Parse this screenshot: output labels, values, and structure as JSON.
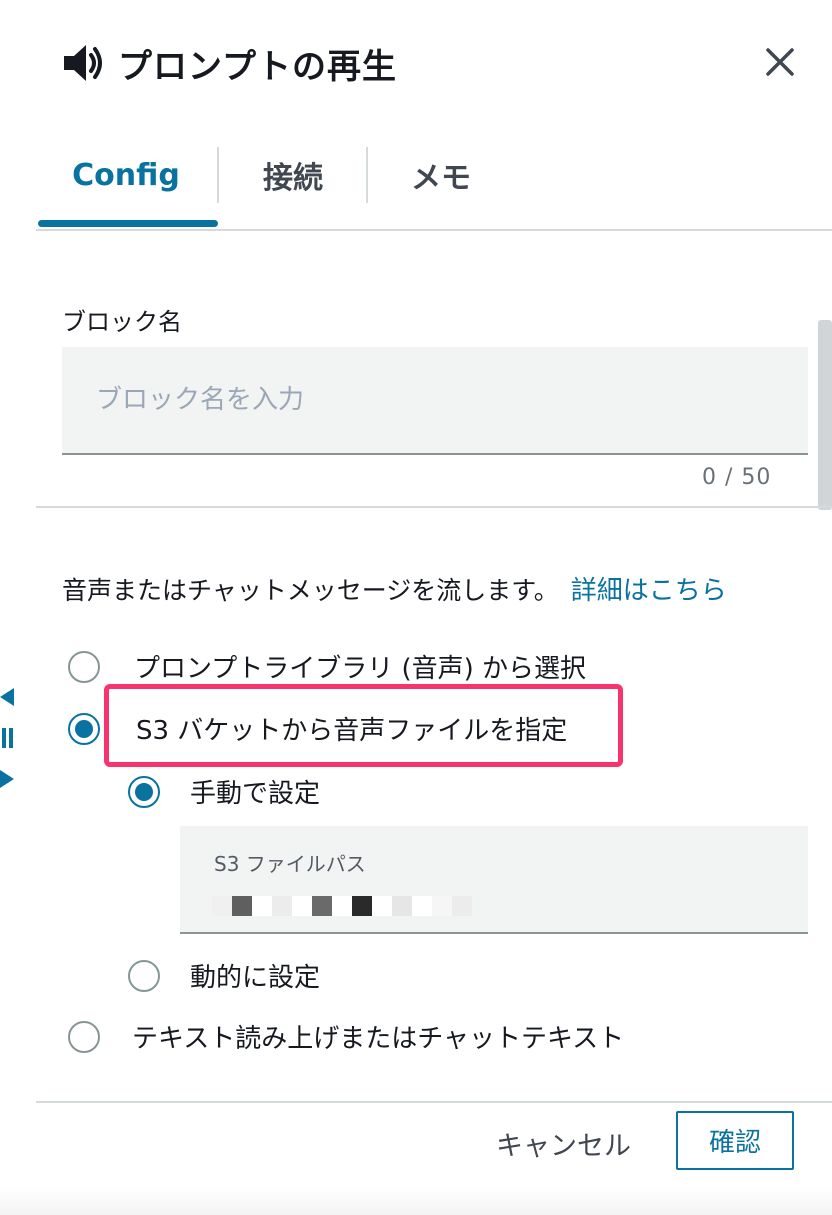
{
  "header": {
    "title": "プロンプトの再生",
    "icon": "speaker-icon",
    "close_icon": "close-icon"
  },
  "tabs": [
    {
      "label": "Config",
      "active": true
    },
    {
      "label": "接続",
      "active": false
    },
    {
      "label": "メモ",
      "active": false
    }
  ],
  "block_name": {
    "label": "ブロック名",
    "value": "",
    "placeholder": "ブロック名を入力",
    "counter": "0 / 50"
  },
  "description": {
    "text": "音声またはチャットメッセージを流します。",
    "link": "詳細はこちら"
  },
  "options": {
    "prompt_library": {
      "label": "プロンプトライブラリ (音声) から選択",
      "checked": false
    },
    "s3_bucket": {
      "label": "S3 バケットから音声ファイルを指定",
      "checked": true
    },
    "manual": {
      "label": "手動で設定",
      "checked": true
    },
    "s3_path": {
      "label": "S3 ファイルパス",
      "value_redacted": true
    },
    "dynamic": {
      "label": "動的に設定",
      "checked": false
    },
    "text_to_speech": {
      "label": "テキスト読み上げまたはチャットテキスト",
      "checked": false
    }
  },
  "footer": {
    "cancel": "キャンセル",
    "confirm": "確認"
  },
  "colors": {
    "accent": "#0972a0",
    "highlight": "#f7346e",
    "text": "#16191f",
    "input_bg": "#f2f3f3"
  }
}
